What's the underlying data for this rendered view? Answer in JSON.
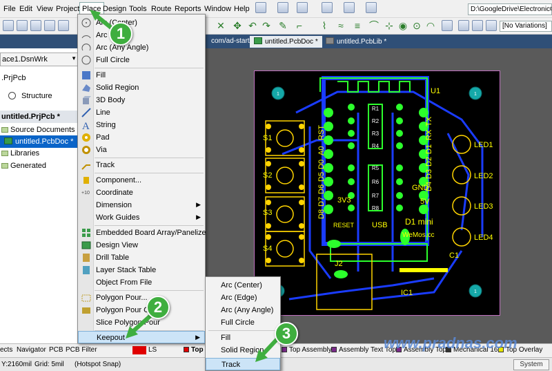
{
  "menubar": {
    "items": [
      "File",
      "Edit",
      "View",
      "Project",
      "Place",
      "Design",
      "Tools",
      "Route",
      "Reports",
      "Window",
      "Help"
    ],
    "path": "D:\\GoogleDrive\\ElectronicC"
  },
  "toolbar": {
    "variations": "[No Variations]"
  },
  "tabs": {
    "url_fragment": "com/ad-start/",
    "pcbdoc": "untitled.PcbDoc *",
    "pcblib": "untitled.PcbLib *"
  },
  "left_panel": {
    "workspace": "ace1.DsnWrk",
    "project_short": ".PrjPcb",
    "structure": "Structure",
    "project": "untitled.PrjPcb *",
    "source_documents": "Source Documents",
    "pcbdoc": "untitled.PcbDoc *",
    "libraries": "Libraries",
    "generated": "Generated"
  },
  "place_menu": {
    "items": [
      "Arc (Center)",
      "Arc (Edge)",
      "Arc (Any Angle)",
      "Full Circle",
      "Fill",
      "Solid Region",
      "3D Body",
      "Line",
      "String",
      "Pad",
      "Via",
      "Track",
      "Component...",
      "Coordinate",
      "Dimension",
      "Work Guides",
      "Embedded Board Array/Panelize",
      "Design View",
      "Drill Table",
      "Layer Stack Table",
      "Object From File",
      "Polygon Pour...",
      "Polygon Pour Cutout",
      "Slice Polygon Pour",
      "Keepout"
    ]
  },
  "keepout_submenu": {
    "items": [
      "Arc (Center)",
      "Arc (Edge)",
      "Arc (Any Angle)",
      "Full Circle",
      "Fill",
      "Solid Region",
      "Track"
    ]
  },
  "board": {
    "u1": "U1",
    "pins_left": [
      "RST",
      "A0",
      "D0",
      "D5",
      "D6",
      "D7",
      "D8",
      "3V3"
    ],
    "pins_right": [
      "TX",
      "RX",
      "D1",
      "D2",
      "D3",
      "D4",
      "GND",
      "5V"
    ],
    "resistors": [
      "R1",
      "R2",
      "R3",
      "R4",
      "R5",
      "R6",
      "R7",
      "R8"
    ],
    "switches": [
      "S1",
      "S2",
      "S3",
      "S4"
    ],
    "leds": [
      "LED1",
      "LED2",
      "LED3",
      "LED4"
    ],
    "reset": "RESET",
    "usb": "USB",
    "d1mini": "D1 mini",
    "wemos": "WeMos.cc",
    "j2": "J2",
    "c1": "C1",
    "ic1": "IC1",
    "gnd": "GND",
    "one": "1"
  },
  "bottom_tabs": {
    "left": [
      "ects",
      "Navigator",
      "PCB",
      "PCB Filter"
    ],
    "ls": "LS",
    "top": "Top",
    "layers": [
      "Top Assembly",
      "Assembly Text Top",
      "Assembly Top",
      "Mechanical 16",
      "Top Overlay"
    ]
  },
  "status": {
    "coords": "Y:2160mil",
    "grid": "Grid: 5mil",
    "snap": "(Hotspot Snap)",
    "system": "System"
  },
  "badges": [
    "1",
    "2",
    "3"
  ],
  "watermark": "www.pradnas.com"
}
